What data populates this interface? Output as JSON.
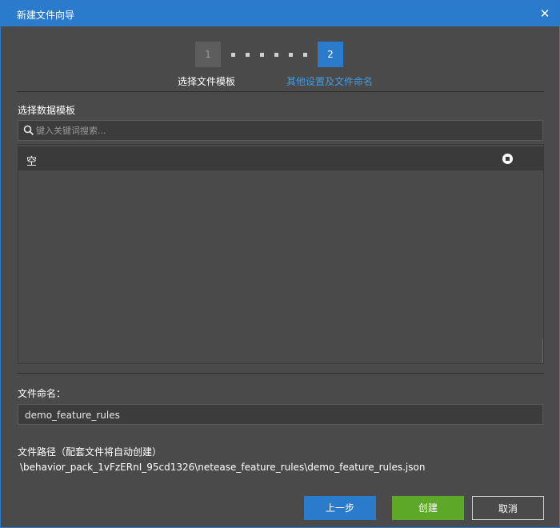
{
  "window": {
    "title": "新建文件向导"
  },
  "stepper": {
    "steps": [
      {
        "number": "1",
        "label": "选择文件模板",
        "state": "done"
      },
      {
        "number": "2",
        "label": "其他设置及文件命名",
        "state": "active"
      }
    ]
  },
  "template_section": {
    "label": "选择数据模板",
    "search_placeholder": "键入关键词搜索...",
    "items": [
      {
        "label": "空",
        "selected": true
      }
    ]
  },
  "filename_section": {
    "label": "文件命名：",
    "value": "demo_feature_rules"
  },
  "path_section": {
    "label": "文件路径（配套文件将自动创建）",
    "value": "\\behavior_pack_1vFzERnI_95cd1326\\netease_feature_rules\\demo_feature_rules.json"
  },
  "buttons": {
    "prev": "上一步",
    "create": "创建",
    "cancel": "取消"
  },
  "colors": {
    "accent": "#2b7bcd",
    "create": "#5ea829",
    "active_label": "#3e9ce6",
    "background": "#4a4a4a"
  },
  "icons": {
    "close": "close-icon",
    "search": "search-icon",
    "radio": "radio-selected-icon"
  }
}
